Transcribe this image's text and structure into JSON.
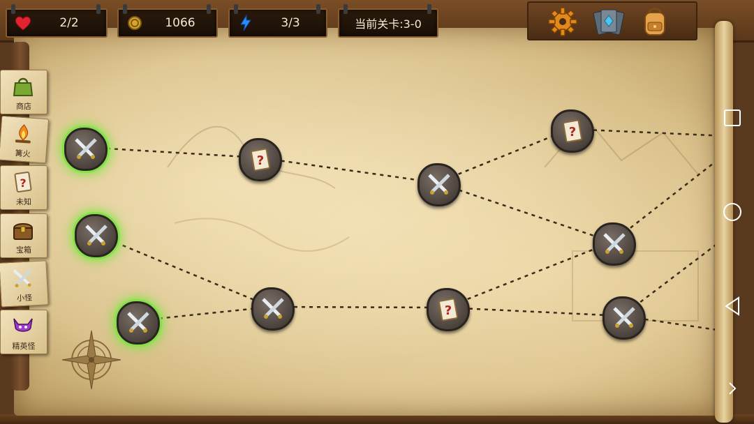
{
  "hud": {
    "lives": "2/2",
    "coins": "1066",
    "energy": "3/3",
    "stage": "当前关卡:3-0"
  },
  "top_icons": [
    "gear-icon",
    "card-deck-icon",
    "backpack-icon"
  ],
  "legend": [
    {
      "label": "商店",
      "icon": "shop-bag-icon"
    },
    {
      "label": "篝火",
      "icon": "campfire-icon"
    },
    {
      "label": "未知",
      "icon": "unknown-card-icon"
    },
    {
      "label": "宝箱",
      "icon": "treasure-chest-icon"
    },
    {
      "label": "小怪",
      "icon": "crossed-swords-icon"
    },
    {
      "label": "精英怪",
      "icon": "elite-demon-icon"
    }
  ],
  "colors": {
    "active_glow": "#86e04a",
    "node_stone": "#4c433d",
    "path": "#3a2a18"
  }
}
